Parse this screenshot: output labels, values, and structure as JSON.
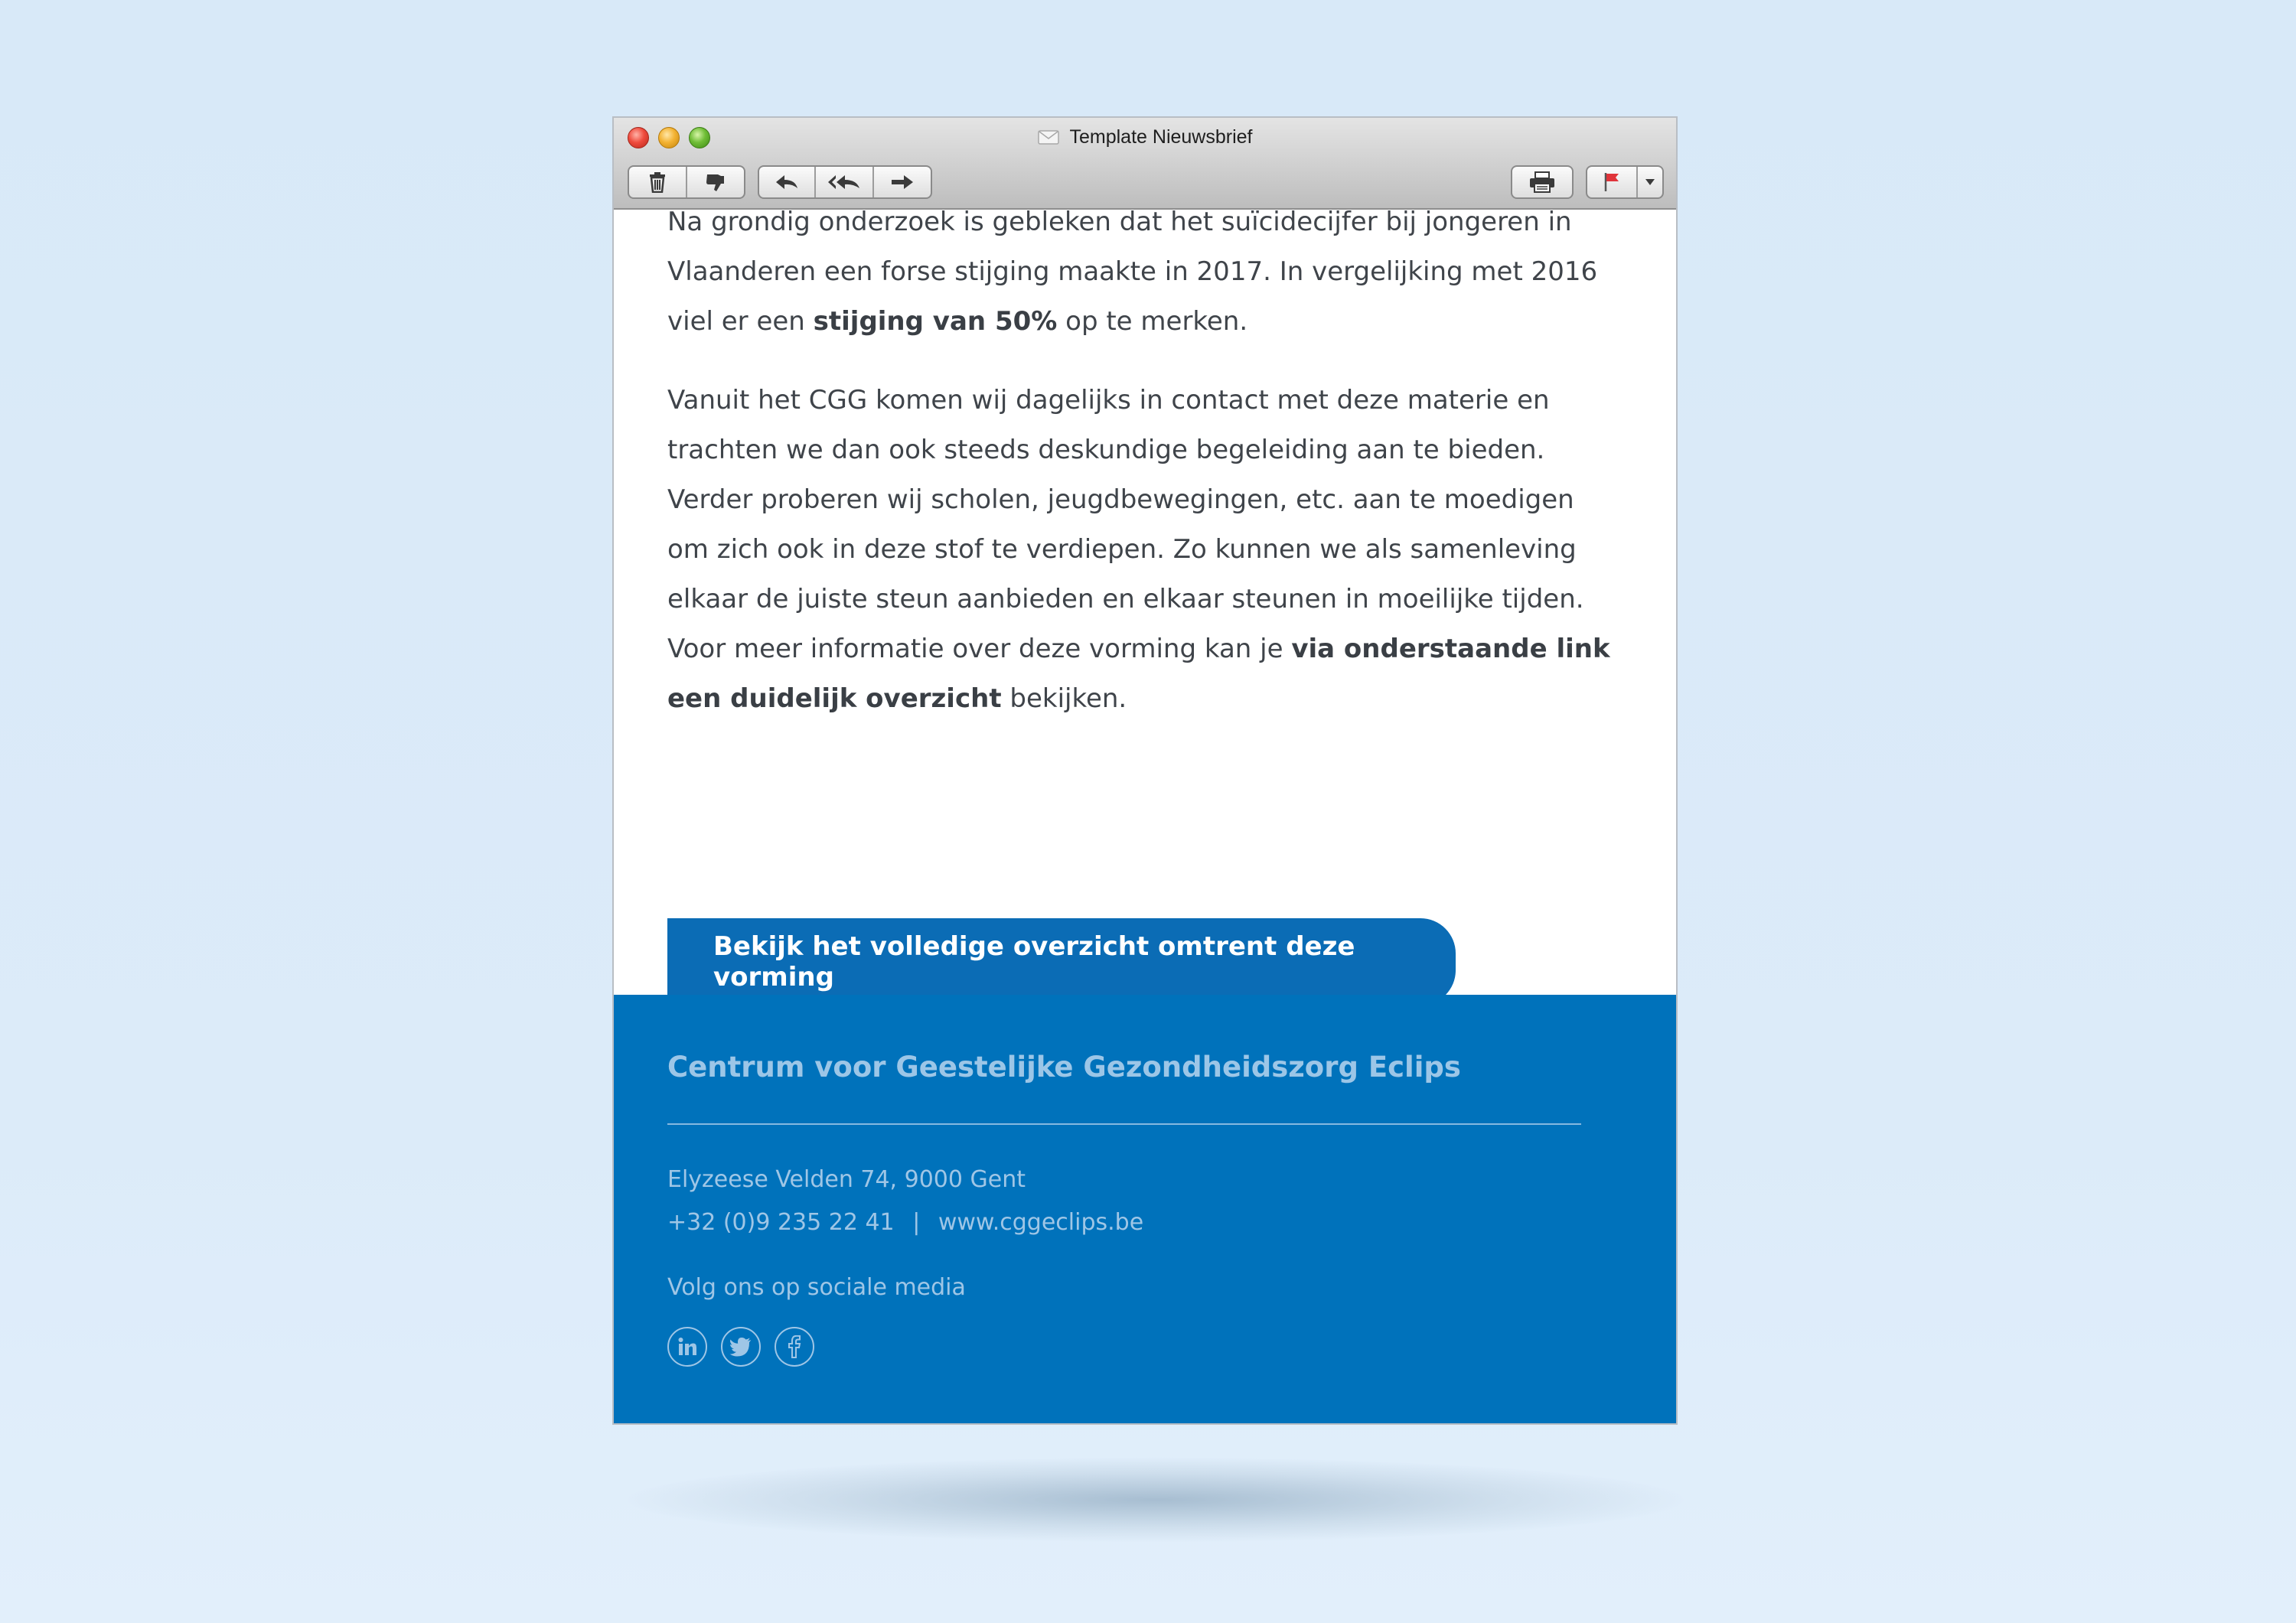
{
  "window": {
    "title": "Template Nieuwsbrief"
  },
  "toolbar": {
    "icons": [
      "trash-icon",
      "junk-icon",
      "reply-icon",
      "reply-all-icon",
      "forward-icon",
      "print-icon",
      "flag-icon",
      "chevron-down-icon"
    ]
  },
  "email": {
    "paragraph1": {
      "text_before": "Na grondig onderzoek is gebleken dat het suïcidecijfer bij jongeren in Vlaanderen een forse stijging maakte in 2017. In vergelijking met 2016 viel er een ",
      "bold": "stijging van 50%",
      "text_after": " op te merken."
    },
    "paragraph2": {
      "text_before": "Vanuit het CGG komen wij dagelijks in contact met deze materie en trachten we dan ook steeds deskundige begeleiding aan te bieden. Verder proberen wij scholen, jeugdbewegingen, etc. aan te moedigen om zich ook in deze stof te verdiepen. Zo kunnen we als samenleving elkaar de juiste steun aanbieden en elkaar steunen in moeilijke tijden. Voor meer informatie over deze vorming kan je ",
      "bold": "via onderstaande link een duidelijk overzicht",
      "text_after": " bekijken."
    },
    "cta_label": "Bekijk het volledige overzicht omtrent deze vorming"
  },
  "footer": {
    "org_name": "Centrum voor Geestelijke Gezondheidszorg Eclips",
    "address": "Elyzeese Velden 74, 9000 Gent",
    "phone": "+32 (0)9 235 22 41",
    "separator": "|",
    "website": "www.cggeclips.be",
    "social_label": "Volg ons op sociale media",
    "social_icons": [
      "linkedin-icon",
      "twitter-icon",
      "facebook-icon"
    ]
  },
  "colors": {
    "background": "#d9eaf8",
    "brand_blue": "#0072bb",
    "button_blue": "#0b6cb5",
    "footer_text": "#9fc6e6",
    "body_text": "#3f444a"
  }
}
